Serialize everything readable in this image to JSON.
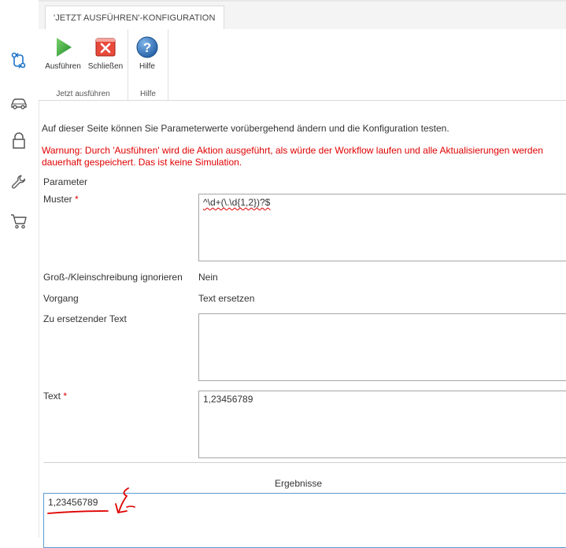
{
  "tab": {
    "label": "'JETZT AUSFÜHREN'-KONFIGURATION"
  },
  "sidebar": {
    "icons": [
      "workflow-icon",
      "car-icon",
      "lock-icon",
      "wrench-icon",
      "cart-icon"
    ]
  },
  "ribbon": {
    "run_label": "Ausführen",
    "close_label": "Schließen",
    "help_label": "Hilfe",
    "group_run": "Jetzt ausführen",
    "group_help": "Hilfe"
  },
  "main": {
    "intro": "Auf dieser Seite können Sie Parameterwerte vorübergehend ändern und die Konfiguration testen.",
    "warning": "Warnung: Durch 'Ausführen' wird die Aktion ausgeführt, als würde der Workflow laufen und alle Aktualisierungen werden dauerhaft gespeichert. Das ist keine Simulation.",
    "section_title": "Parameter",
    "fields": {
      "pattern_label": "Muster",
      "pattern_value": "^\\d+(\\.\\d{1,2})?$",
      "case_label": "Groß-/Kleinschreibung ignorieren",
      "case_value": "Nein",
      "operation_label": "Vorgang",
      "operation_value": "Text ersetzen",
      "replace_label": "Zu ersetzender Text",
      "replace_value": "",
      "text_label": "Text",
      "text_value": "1,23456789"
    },
    "required_mark": "*",
    "results_title": "Ergebnisse",
    "result_value": "1,23456789"
  },
  "colors": {
    "accent": "#1a73c9",
    "warning": "#e00000",
    "run": "#2e9b3a",
    "close": "#d9302a",
    "help": "#2f6fb3"
  }
}
